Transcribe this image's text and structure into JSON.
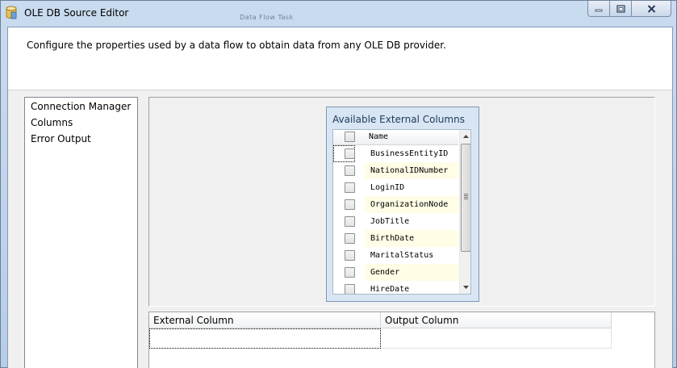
{
  "window": {
    "title": "OLE DB Source Editor",
    "background_title": "Data Flow Task"
  },
  "header": {
    "description": "Configure the properties used by a data flow to obtain data from any OLE DB provider."
  },
  "nav": {
    "items": [
      {
        "label": "Connection Manager"
      },
      {
        "label": "Columns",
        "selected": true
      },
      {
        "label": "Error Output"
      }
    ]
  },
  "available_columns": {
    "title": "Available External Columns",
    "header": "Name",
    "rows": [
      {
        "name": "BusinessEntityID",
        "checked": false
      },
      {
        "name": "NationalIDNumber",
        "checked": false
      },
      {
        "name": "LoginID",
        "checked": false
      },
      {
        "name": "OrganizationNode",
        "checked": false
      },
      {
        "name": "JobTitle",
        "checked": false
      },
      {
        "name": "BirthDate",
        "checked": false
      },
      {
        "name": "MaritalStatus",
        "checked": false
      },
      {
        "name": "Gender",
        "checked": false
      },
      {
        "name": "HireDate",
        "checked": false
      }
    ]
  },
  "mapping": {
    "columns": [
      "External Column",
      "Output Column"
    ],
    "rows": [
      {
        "external": "",
        "output": ""
      }
    ]
  },
  "icons": {
    "app": "database-cylinder-icon",
    "minimize": "minimize-icon",
    "maximize": "restore-icon",
    "close": "close-icon",
    "scroll_up": "chevron-up-icon",
    "scroll_down": "chevron-down-icon"
  },
  "colors": {
    "alt_row": "#fffde6",
    "avail_panel": "#d8e5f3",
    "title_accent": "#1e395b"
  }
}
